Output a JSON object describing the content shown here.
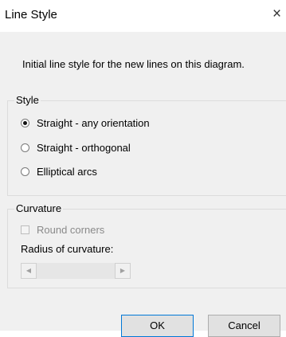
{
  "window": {
    "title": "Line Style",
    "close_glyph": "×"
  },
  "intro_text": "Initial line style for the new lines on this diagram.",
  "style_group": {
    "label": "Style",
    "options": [
      {
        "label": "Straight - any orientation",
        "checked": true
      },
      {
        "label": "Straight - orthogonal",
        "checked": false
      },
      {
        "label": "Elliptical arcs",
        "checked": false
      }
    ]
  },
  "curvature_group": {
    "label": "Curvature",
    "round_corners_label": "Round corners",
    "round_corners_checked": false,
    "round_corners_enabled": false,
    "radius_label": "Radius of curvature:",
    "scroll_left_glyph": "◀",
    "scroll_right_glyph": "▶"
  },
  "buttons": {
    "ok": "OK",
    "cancel": "Cancel"
  }
}
